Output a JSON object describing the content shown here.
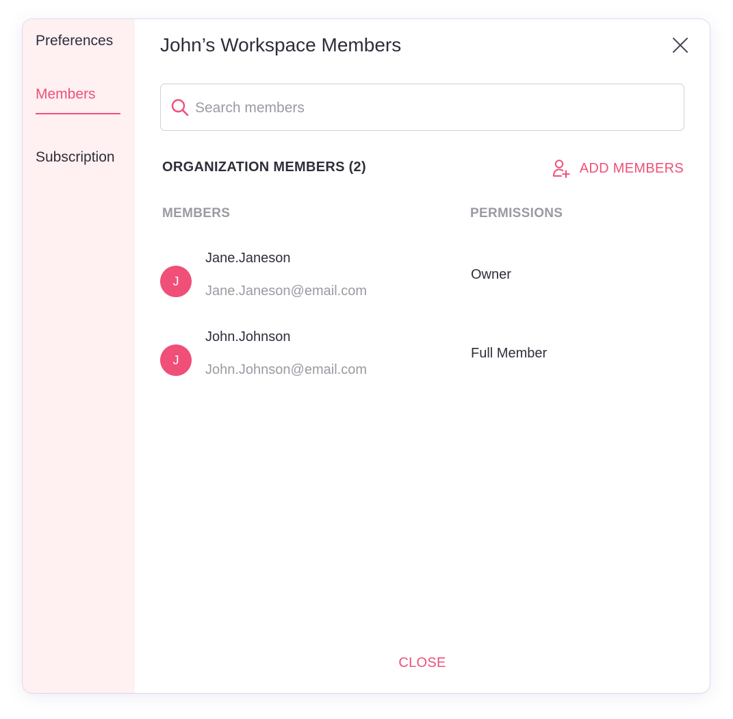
{
  "sidebar": {
    "items": [
      {
        "label": "Preferences"
      },
      {
        "label": "Members"
      },
      {
        "label": "Subscription"
      }
    ],
    "active": "Members"
  },
  "dialog": {
    "title": "John’s Workspace Members",
    "close_icon": "close-icon"
  },
  "search": {
    "placeholder": "Search members",
    "value": "",
    "icon": "search-icon"
  },
  "section": {
    "title": "ORGANIZATION MEMBERS (2)",
    "add_label": "ADD MEMBERS",
    "add_icon": "add-user-icon"
  },
  "table": {
    "columns": [
      "MEMBERS",
      "PERMISSIONS"
    ],
    "rows": [
      {
        "initial": "J",
        "name": "Jane.Janeson",
        "email": "Jane.Janeson@email.com",
        "permission": "Owner"
      },
      {
        "initial": "J",
        "name": "John.Johnson",
        "email": "John.Johnson@email.com",
        "permission": "Full Member"
      }
    ]
  },
  "footer": {
    "close_label": "CLOSE"
  },
  "colors": {
    "accent": "#ef4f78",
    "sidebar_bg": "#fff0f2",
    "text": "#2e2e3a",
    "muted": "#9a9aa2"
  }
}
